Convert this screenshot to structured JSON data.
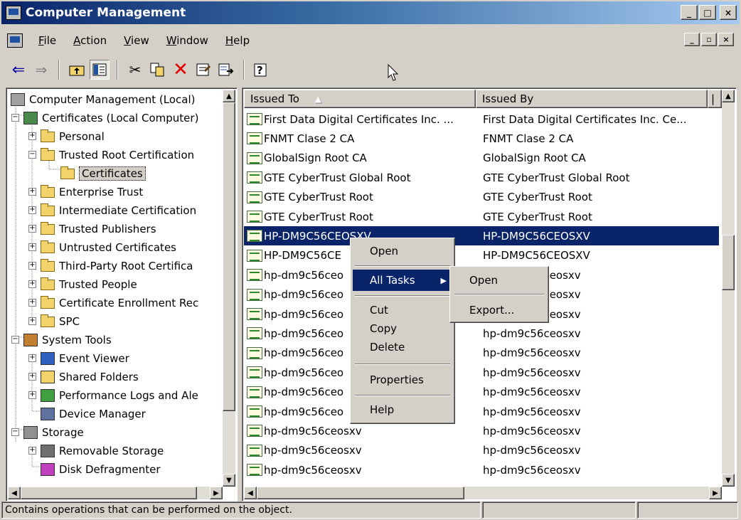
{
  "window": {
    "title": "Computer Management"
  },
  "caption_buttons": [
    "_",
    "□",
    "×"
  ],
  "mdi_buttons": [
    "_",
    "▫",
    "×"
  ],
  "menu": [
    "File",
    "Action",
    "View",
    "Window",
    "Help"
  ],
  "toolbar": [
    "back-icon",
    "forward-icon",
    "up-folder-icon",
    "show-hide-tree-icon",
    "cut-icon",
    "copy-icon",
    "delete-icon",
    "properties-icon",
    "export-list-icon",
    "help-icon"
  ],
  "tree": [
    {
      "label": "Computer Management (Local)",
      "icon": "computer-icon",
      "indent": 0
    },
    {
      "label": "Certificates (Local Computer)",
      "icon": "certificates-snapin-icon",
      "indent": 1,
      "expander": "−"
    },
    {
      "label": "Personal",
      "icon": "folder-icon",
      "indent": 2,
      "expander": "+"
    },
    {
      "label": "Trusted Root Certification",
      "icon": "folder-icon",
      "indent": 2,
      "expander": "−"
    },
    {
      "label": "Certificates",
      "icon": "open-folder-icon",
      "indent": 3,
      "selected": true
    },
    {
      "label": "Enterprise Trust",
      "icon": "folder-icon",
      "indent": 2,
      "expander": "+"
    },
    {
      "label": "Intermediate Certification",
      "icon": "folder-icon",
      "indent": 2,
      "expander": "+"
    },
    {
      "label": "Trusted Publishers",
      "icon": "folder-icon",
      "indent": 2,
      "expander": "+"
    },
    {
      "label": "Untrusted Certificates",
      "icon": "folder-icon",
      "indent": 2,
      "expander": "+"
    },
    {
      "label": "Third-Party Root Certifica",
      "icon": "folder-icon",
      "indent": 2,
      "expander": "+"
    },
    {
      "label": "Trusted People",
      "icon": "folder-icon",
      "indent": 2,
      "expander": "+"
    },
    {
      "label": "Certificate Enrollment Rec",
      "icon": "folder-icon",
      "indent": 2,
      "expander": "+"
    },
    {
      "label": "SPC",
      "icon": "folder-icon",
      "indent": 2,
      "expander": "+"
    },
    {
      "label": "System Tools",
      "icon": "system-tools-icon",
      "indent": 1,
      "expander": "−"
    },
    {
      "label": "Event Viewer",
      "icon": "event-viewer-icon",
      "indent": 2,
      "expander": "+"
    },
    {
      "label": "Shared Folders",
      "icon": "shared-folders-icon",
      "indent": 2,
      "expander": "+"
    },
    {
      "label": "Performance Logs and Ale",
      "icon": "performance-icon",
      "indent": 2,
      "expander": "+"
    },
    {
      "label": "Device Manager",
      "icon": "device-manager-icon",
      "indent": 2
    },
    {
      "label": "Storage",
      "icon": "storage-icon",
      "indent": 1,
      "expander": "−"
    },
    {
      "label": "Removable Storage",
      "icon": "removable-storage-icon",
      "indent": 2,
      "expander": "+"
    },
    {
      "label": "Disk Defragmenter",
      "icon": "defrag-icon",
      "indent": 2
    }
  ],
  "list": {
    "headers": [
      "Issued To",
      "Issued By"
    ],
    "rows": [
      {
        "to": "First Data Digital Certificates Inc. ...",
        "by": "First Data Digital Certificates Inc. Ce..."
      },
      {
        "to": "FNMT Clase 2 CA",
        "by": "FNMT Clase 2 CA"
      },
      {
        "to": "GlobalSign Root CA",
        "by": "GlobalSign Root CA"
      },
      {
        "to": "GTE CyberTrust Global Root",
        "by": "GTE CyberTrust Global Root"
      },
      {
        "to": "GTE CyberTrust Root",
        "by": "GTE CyberTrust Root"
      },
      {
        "to": "GTE CyberTrust Root",
        "by": "GTE CyberTrust Root"
      },
      {
        "to": "HP-DM9C56CEOSXV",
        "by": "HP-DM9C56CEOSXV",
        "selected": true
      },
      {
        "to": "HP-DM9C56CE",
        "by": "HP-DM9C56CEOSXV"
      },
      {
        "to": "hp-dm9c56ceo",
        "by": "hp-dm9c56ceosxv"
      },
      {
        "to": "hp-dm9c56ceo",
        "by": "hp-dm9c56ceosxv"
      },
      {
        "to": "hp-dm9c56ceo",
        "by": "hp-dm9c56ceosxv"
      },
      {
        "to": "hp-dm9c56ceo",
        "by": "hp-dm9c56ceosxv"
      },
      {
        "to": "hp-dm9c56ceo",
        "by": "hp-dm9c56ceosxv"
      },
      {
        "to": "hp-dm9c56ceo",
        "by": "hp-dm9c56ceosxv"
      },
      {
        "to": "hp-dm9c56ceo",
        "by": "hp-dm9c56ceosxv"
      },
      {
        "to": "hp-dm9c56ceo",
        "by": "hp-dm9c56ceosxv"
      },
      {
        "to": "hp-dm9c56ceosxv",
        "by": "hp-dm9c56ceosxv"
      },
      {
        "to": "hp-dm9c56ceosxv",
        "by": "hp-dm9c56ceosxv"
      },
      {
        "to": "hp-dm9c56ceosxv",
        "by": "hp-dm9c56ceosxv"
      }
    ]
  },
  "context_menu": {
    "open": "Open",
    "all_tasks": "All Tasks",
    "cut": "Cut",
    "copy": "Copy",
    "delete": "Delete",
    "properties": "Properties",
    "help": "Help"
  },
  "submenu": {
    "open": "Open",
    "export": "Export..."
  },
  "status": {
    "text": "Contains operations that can be performed on the object."
  }
}
